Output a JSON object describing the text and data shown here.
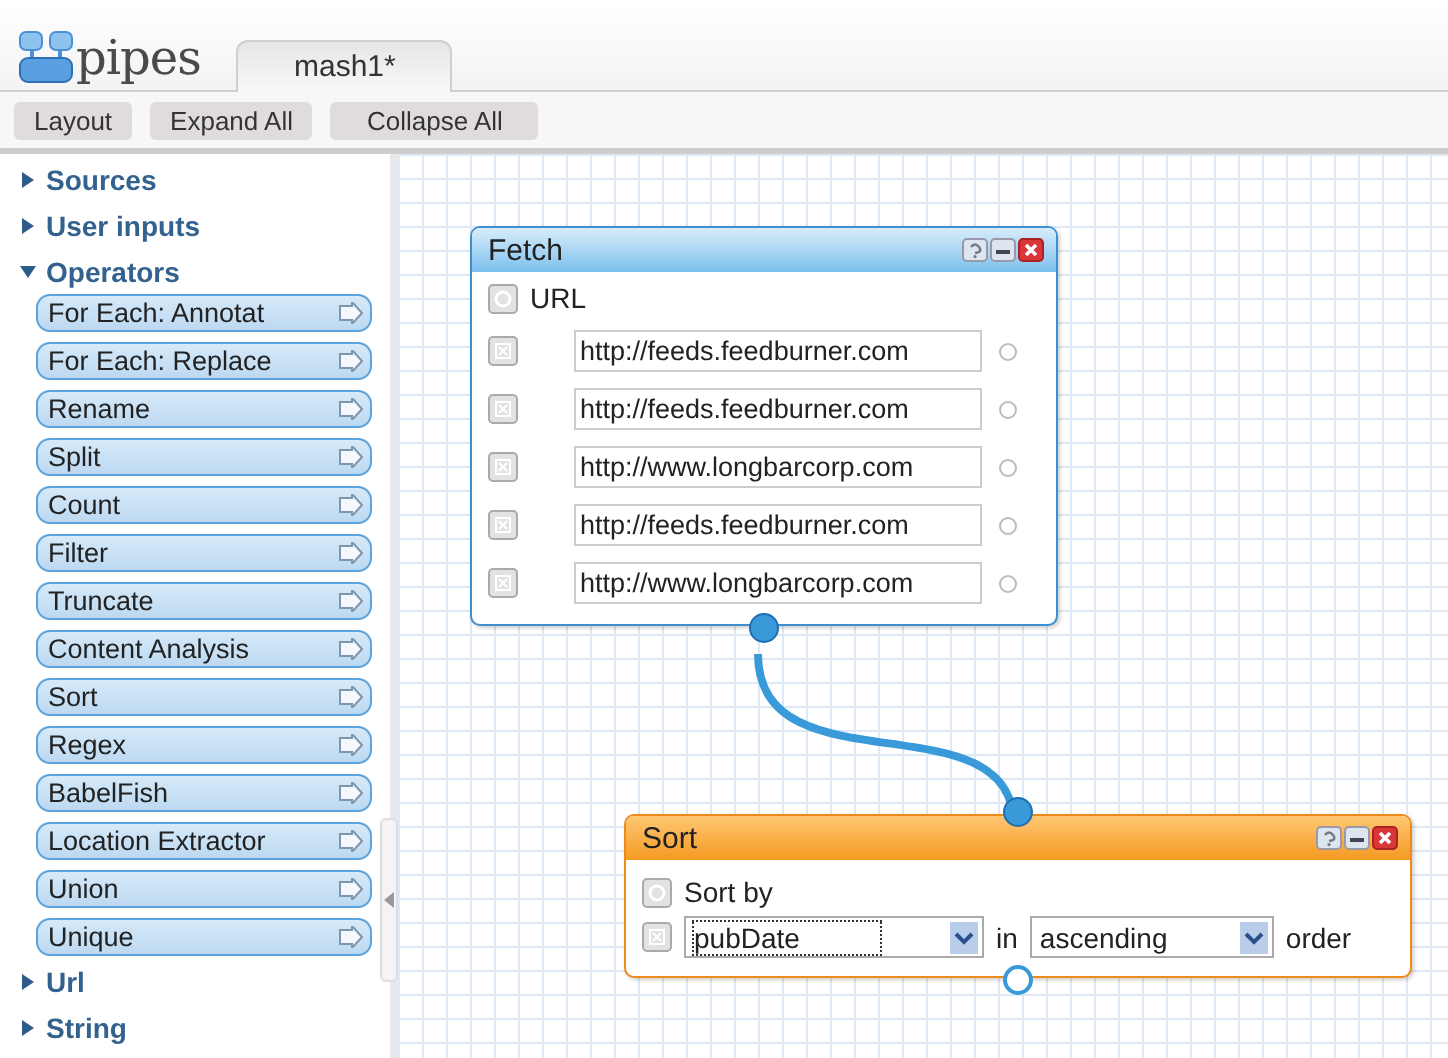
{
  "logo": {
    "text": "pipes"
  },
  "tabs": [
    {
      "label": "mash1*",
      "selected": true
    }
  ],
  "toolbar": [
    "Layout",
    "Expand All",
    "Collapse All"
  ],
  "sidebar": {
    "categories": [
      {
        "label": "Sources",
        "expanded": false
      },
      {
        "label": "User inputs",
        "expanded": false
      },
      {
        "label": "Operators",
        "expanded": true,
        "children": [
          {
            "label": "For Each: Annotat"
          },
          {
            "label": "For Each: Replace"
          },
          {
            "label": "Rename"
          },
          {
            "label": "Split"
          },
          {
            "label": "Count"
          },
          {
            "label": "Filter"
          },
          {
            "label": "Truncate"
          },
          {
            "label": "Content Analysis"
          },
          {
            "label": "Sort"
          },
          {
            "label": "Regex"
          },
          {
            "label": "BabelFish"
          },
          {
            "label": "Location Extractor"
          },
          {
            "label": "Union"
          },
          {
            "label": "Unique"
          }
        ]
      },
      {
        "label": "Url",
        "expanded": false
      },
      {
        "label": "String",
        "expanded": false
      }
    ]
  },
  "modules": [
    {
      "kind": "fetch",
      "title": "Fetch",
      "selected": false,
      "field_label": "URL",
      "urls": [
        "http://feeds.feedburner.com",
        "http://feeds.feedburner.com",
        "http://www.longbarcorp.com",
        "http://feeds.feedburner.com",
        "http://www.longbarcorp.com"
      ]
    },
    {
      "kind": "sort",
      "title": "Sort",
      "selected": true,
      "field_label": "Sort by",
      "sort_field": "pubDate",
      "word_in": "in",
      "direction": "ascending",
      "word_order": "order"
    }
  ]
}
